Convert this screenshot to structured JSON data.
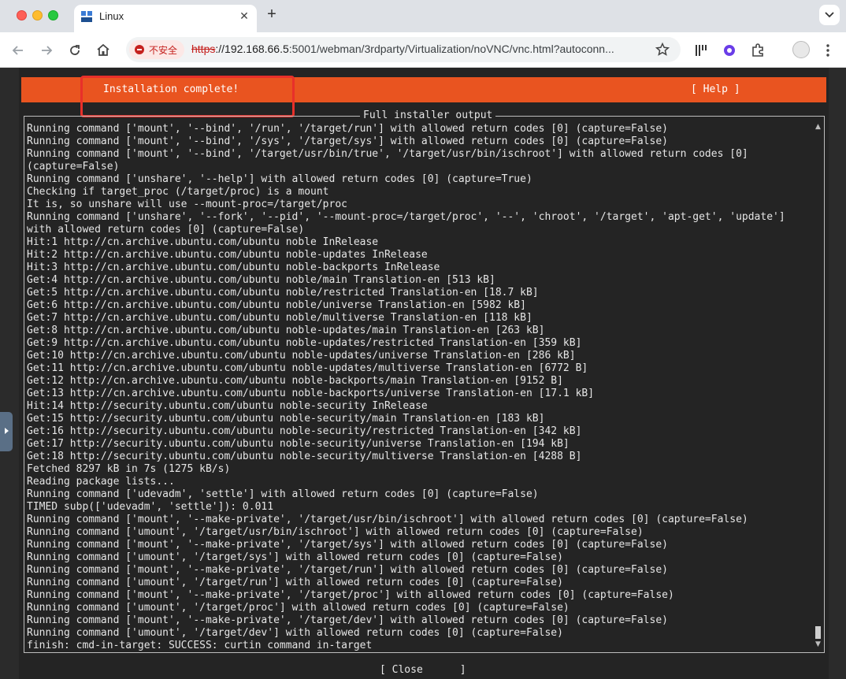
{
  "browser": {
    "tab_title": "Linux",
    "tab_close": "✕",
    "new_tab": "+",
    "security_label": "不安全",
    "url_scheme": "https",
    "url_host": "://192.168.66.5",
    "url_rest": ":5001/webman/3rdparty/Virtualization/noVNC/vnc.html?autoconn..."
  },
  "installer": {
    "header_title": "Installation complete!",
    "header_help": "[ Help ]",
    "output_title": "Full installer output",
    "close_button": "[ Close      ]",
    "log_lines": [
      "Running command ['mount', '--bind', '/run', '/target/run'] with allowed return codes [0] (capture=False)",
      "Running command ['mount', '--bind', '/sys', '/target/sys'] with allowed return codes [0] (capture=False)",
      "Running command ['mount', '--bind', '/target/usr/bin/true', '/target/usr/bin/ischroot'] with allowed return codes [0]",
      "(capture=False)",
      "Running command ['unshare', '--help'] with allowed return codes [0] (capture=True)",
      "Checking if target_proc (/target/proc) is a mount",
      "It is, so unshare will use --mount-proc=/target/proc",
      "Running command ['unshare', '--fork', '--pid', '--mount-proc=/target/proc', '--', 'chroot', '/target', 'apt-get', 'update']",
      "with allowed return codes [0] (capture=False)",
      "Hit:1 http://cn.archive.ubuntu.com/ubuntu noble InRelease",
      "Hit:2 http://cn.archive.ubuntu.com/ubuntu noble-updates InRelease",
      "Hit:3 http://cn.archive.ubuntu.com/ubuntu noble-backports InRelease",
      "Get:4 http://cn.archive.ubuntu.com/ubuntu noble/main Translation-en [513 kB]",
      "Get:5 http://cn.archive.ubuntu.com/ubuntu noble/restricted Translation-en [18.7 kB]",
      "Get:6 http://cn.archive.ubuntu.com/ubuntu noble/universe Translation-en [5982 kB]",
      "Get:7 http://cn.archive.ubuntu.com/ubuntu noble/multiverse Translation-en [118 kB]",
      "Get:8 http://cn.archive.ubuntu.com/ubuntu noble-updates/main Translation-en [263 kB]",
      "Get:9 http://cn.archive.ubuntu.com/ubuntu noble-updates/restricted Translation-en [359 kB]",
      "Get:10 http://cn.archive.ubuntu.com/ubuntu noble-updates/universe Translation-en [286 kB]",
      "Get:11 http://cn.archive.ubuntu.com/ubuntu noble-updates/multiverse Translation-en [6772 B]",
      "Get:12 http://cn.archive.ubuntu.com/ubuntu noble-backports/main Translation-en [9152 B]",
      "Get:13 http://cn.archive.ubuntu.com/ubuntu noble-backports/universe Translation-en [17.1 kB]",
      "Hit:14 http://security.ubuntu.com/ubuntu noble-security InRelease",
      "Get:15 http://security.ubuntu.com/ubuntu noble-security/main Translation-en [183 kB]",
      "Get:16 http://security.ubuntu.com/ubuntu noble-security/restricted Translation-en [342 kB]",
      "Get:17 http://security.ubuntu.com/ubuntu noble-security/universe Translation-en [194 kB]",
      "Get:18 http://security.ubuntu.com/ubuntu noble-security/multiverse Translation-en [4288 B]",
      "Fetched 8297 kB in 7s (1275 kB/s)",
      "Reading package lists...",
      "Running command ['udevadm', 'settle'] with allowed return codes [0] (capture=False)",
      "TIMED subp(['udevadm', 'settle']): 0.011",
      "Running command ['mount', '--make-private', '/target/usr/bin/ischroot'] with allowed return codes [0] (capture=False)",
      "Running command ['umount', '/target/usr/bin/ischroot'] with allowed return codes [0] (capture=False)",
      "Running command ['mount', '--make-private', '/target/sys'] with allowed return codes [0] (capture=False)",
      "Running command ['umount', '/target/sys'] with allowed return codes [0] (capture=False)",
      "Running command ['mount', '--make-private', '/target/run'] with allowed return codes [0] (capture=False)",
      "Running command ['umount', '/target/run'] with allowed return codes [0] (capture=False)",
      "Running command ['mount', '--make-private', '/target/proc'] with allowed return codes [0] (capture=False)",
      "Running command ['umount', '/target/proc'] with allowed return codes [0] (capture=False)",
      "Running command ['mount', '--make-private', '/target/dev'] with allowed return codes [0] (capture=False)",
      "Running command ['umount', '/target/dev'] with allowed return codes [0] (capture=False)",
      "finish: cmd-in-target: SUCCESS: curtin command in-target"
    ]
  },
  "colors": {
    "ubuntu_orange": "#e95420",
    "terminal_bg": "#242424",
    "terminal_text": "#e6e6e6",
    "highlight_red": "#e8302a"
  }
}
